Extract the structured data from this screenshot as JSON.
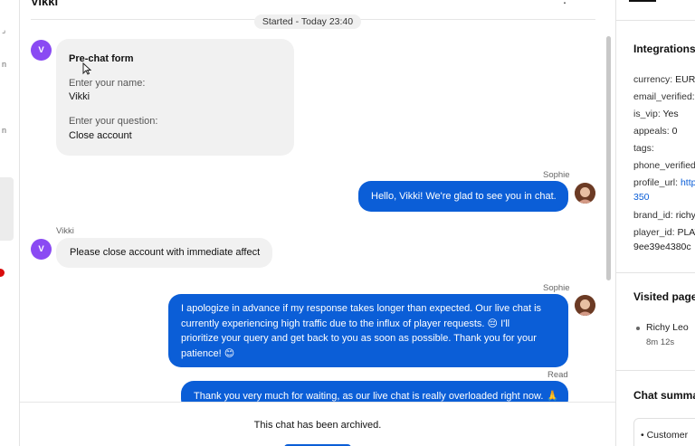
{
  "header": {
    "title": "Vikki"
  },
  "chat": {
    "started_label": "Started - Today 23:40",
    "visitor_initial": "V",
    "prechat": {
      "title": "Pre-chat form",
      "name_label": "Enter your name:",
      "name_value": "Vikki",
      "question_label": "Enter your question:",
      "question_value": "Close account"
    },
    "messages": [
      {
        "sender": "Sophie",
        "text": "Hello, Vikki! We're glad to see you in chat."
      },
      {
        "sender": "Vikki",
        "text": "Please close account with immediate affect"
      },
      {
        "sender": "Sophie",
        "lines": [
          "I apologize in advance if my response takes longer than expected. Our live chat is",
          "currently experiencing high traffic due to the influx of player requests. 😔 I'll",
          "prioritize your query and get back to you as soon as possible. Thank you for your",
          "patience! 😊"
        ]
      },
      {
        "status": "Read",
        "text": "Thank you very much for waiting, as our live chat is really overloaded right now. 🙏"
      }
    ],
    "archived_text": "This chat has been archived."
  },
  "right_panel": {
    "integrations_title": "Integrations",
    "fields": [
      {
        "key": "currency:",
        "value": "EUR"
      },
      {
        "key": "email_verified:",
        "value": ""
      },
      {
        "key": "is_vip:",
        "value": "Yes"
      },
      {
        "key": "appeals:",
        "value": "0"
      },
      {
        "key": "tags:",
        "value": ""
      },
      {
        "key": "phone_verified",
        "value": ""
      },
      {
        "key": "profile_url:",
        "value": "http"
      },
      {
        "key": "",
        "value": "350"
      },
      {
        "key": "brand_id:",
        "value": "richy"
      },
      {
        "key": "player_id:",
        "value": "PLAT"
      },
      {
        "key": "",
        "value": "9ee39e4380c"
      }
    ],
    "visited_title": "Visited page",
    "visited_name": "Richy Leo",
    "visited_time": "8m 12s",
    "summary_title": "Chat summa",
    "summary_item": "Customer"
  },
  "colors": {
    "accent": "#0b5ed7",
    "visitor_avatar": "#8a4af3",
    "bubble_in": "#f1f1f1"
  }
}
